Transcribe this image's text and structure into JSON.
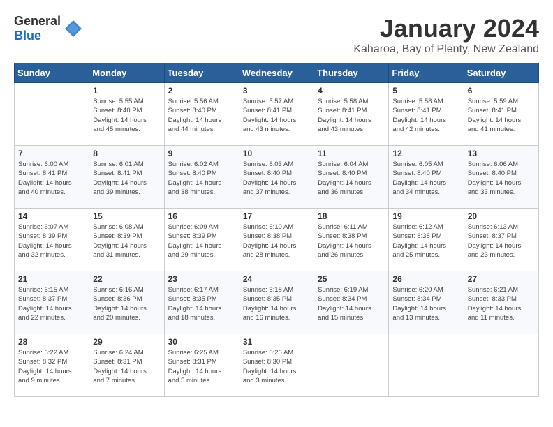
{
  "header": {
    "logo_general": "General",
    "logo_blue": "Blue",
    "title": "January 2024",
    "subtitle": "Kaharoa, Bay of Plenty, New Zealand"
  },
  "calendar": {
    "days_of_week": [
      "Sunday",
      "Monday",
      "Tuesday",
      "Wednesday",
      "Thursday",
      "Friday",
      "Saturday"
    ],
    "weeks": [
      [
        {
          "day": "",
          "info": ""
        },
        {
          "day": "1",
          "info": "Sunrise: 5:55 AM\nSunset: 8:40 PM\nDaylight: 14 hours\nand 45 minutes."
        },
        {
          "day": "2",
          "info": "Sunrise: 5:56 AM\nSunset: 8:40 PM\nDaylight: 14 hours\nand 44 minutes."
        },
        {
          "day": "3",
          "info": "Sunrise: 5:57 AM\nSunset: 8:41 PM\nDaylight: 14 hours\nand 43 minutes."
        },
        {
          "day": "4",
          "info": "Sunrise: 5:58 AM\nSunset: 8:41 PM\nDaylight: 14 hours\nand 43 minutes."
        },
        {
          "day": "5",
          "info": "Sunrise: 5:58 AM\nSunset: 8:41 PM\nDaylight: 14 hours\nand 42 minutes."
        },
        {
          "day": "6",
          "info": "Sunrise: 5:59 AM\nSunset: 8:41 PM\nDaylight: 14 hours\nand 41 minutes."
        }
      ],
      [
        {
          "day": "7",
          "info": "Sunrise: 6:00 AM\nSunset: 8:41 PM\nDaylight: 14 hours\nand 40 minutes."
        },
        {
          "day": "8",
          "info": "Sunrise: 6:01 AM\nSunset: 8:41 PM\nDaylight: 14 hours\nand 39 minutes."
        },
        {
          "day": "9",
          "info": "Sunrise: 6:02 AM\nSunset: 8:40 PM\nDaylight: 14 hours\nand 38 minutes."
        },
        {
          "day": "10",
          "info": "Sunrise: 6:03 AM\nSunset: 8:40 PM\nDaylight: 14 hours\nand 37 minutes."
        },
        {
          "day": "11",
          "info": "Sunrise: 6:04 AM\nSunset: 8:40 PM\nDaylight: 14 hours\nand 36 minutes."
        },
        {
          "day": "12",
          "info": "Sunrise: 6:05 AM\nSunset: 8:40 PM\nDaylight: 14 hours\nand 34 minutes."
        },
        {
          "day": "13",
          "info": "Sunrise: 6:06 AM\nSunset: 8:40 PM\nDaylight: 14 hours\nand 33 minutes."
        }
      ],
      [
        {
          "day": "14",
          "info": "Sunrise: 6:07 AM\nSunset: 8:39 PM\nDaylight: 14 hours\nand 32 minutes."
        },
        {
          "day": "15",
          "info": "Sunrise: 6:08 AM\nSunset: 8:39 PM\nDaylight: 14 hours\nand 31 minutes."
        },
        {
          "day": "16",
          "info": "Sunrise: 6:09 AM\nSunset: 8:39 PM\nDaylight: 14 hours\nand 29 minutes."
        },
        {
          "day": "17",
          "info": "Sunrise: 6:10 AM\nSunset: 8:38 PM\nDaylight: 14 hours\nand 28 minutes."
        },
        {
          "day": "18",
          "info": "Sunrise: 6:11 AM\nSunset: 8:38 PM\nDaylight: 14 hours\nand 26 minutes."
        },
        {
          "day": "19",
          "info": "Sunrise: 6:12 AM\nSunset: 8:38 PM\nDaylight: 14 hours\nand 25 minutes."
        },
        {
          "day": "20",
          "info": "Sunrise: 6:13 AM\nSunset: 8:37 PM\nDaylight: 14 hours\nand 23 minutes."
        }
      ],
      [
        {
          "day": "21",
          "info": "Sunrise: 6:15 AM\nSunset: 8:37 PM\nDaylight: 14 hours\nand 22 minutes."
        },
        {
          "day": "22",
          "info": "Sunrise: 6:16 AM\nSunset: 8:36 PM\nDaylight: 14 hours\nand 20 minutes."
        },
        {
          "day": "23",
          "info": "Sunrise: 6:17 AM\nSunset: 8:35 PM\nDaylight: 14 hours\nand 18 minutes."
        },
        {
          "day": "24",
          "info": "Sunrise: 6:18 AM\nSunset: 8:35 PM\nDaylight: 14 hours\nand 16 minutes."
        },
        {
          "day": "25",
          "info": "Sunrise: 6:19 AM\nSunset: 8:34 PM\nDaylight: 14 hours\nand 15 minutes."
        },
        {
          "day": "26",
          "info": "Sunrise: 6:20 AM\nSunset: 8:34 PM\nDaylight: 14 hours\nand 13 minutes."
        },
        {
          "day": "27",
          "info": "Sunrise: 6:21 AM\nSunset: 8:33 PM\nDaylight: 14 hours\nand 11 minutes."
        }
      ],
      [
        {
          "day": "28",
          "info": "Sunrise: 6:22 AM\nSunset: 8:32 PM\nDaylight: 14 hours\nand 9 minutes."
        },
        {
          "day": "29",
          "info": "Sunrise: 6:24 AM\nSunset: 8:31 PM\nDaylight: 14 hours\nand 7 minutes."
        },
        {
          "day": "30",
          "info": "Sunrise: 6:25 AM\nSunset: 8:31 PM\nDaylight: 14 hours\nand 5 minutes."
        },
        {
          "day": "31",
          "info": "Sunrise: 6:26 AM\nSunset: 8:30 PM\nDaylight: 14 hours\nand 3 minutes."
        },
        {
          "day": "",
          "info": ""
        },
        {
          "day": "",
          "info": ""
        },
        {
          "day": "",
          "info": ""
        }
      ]
    ]
  }
}
